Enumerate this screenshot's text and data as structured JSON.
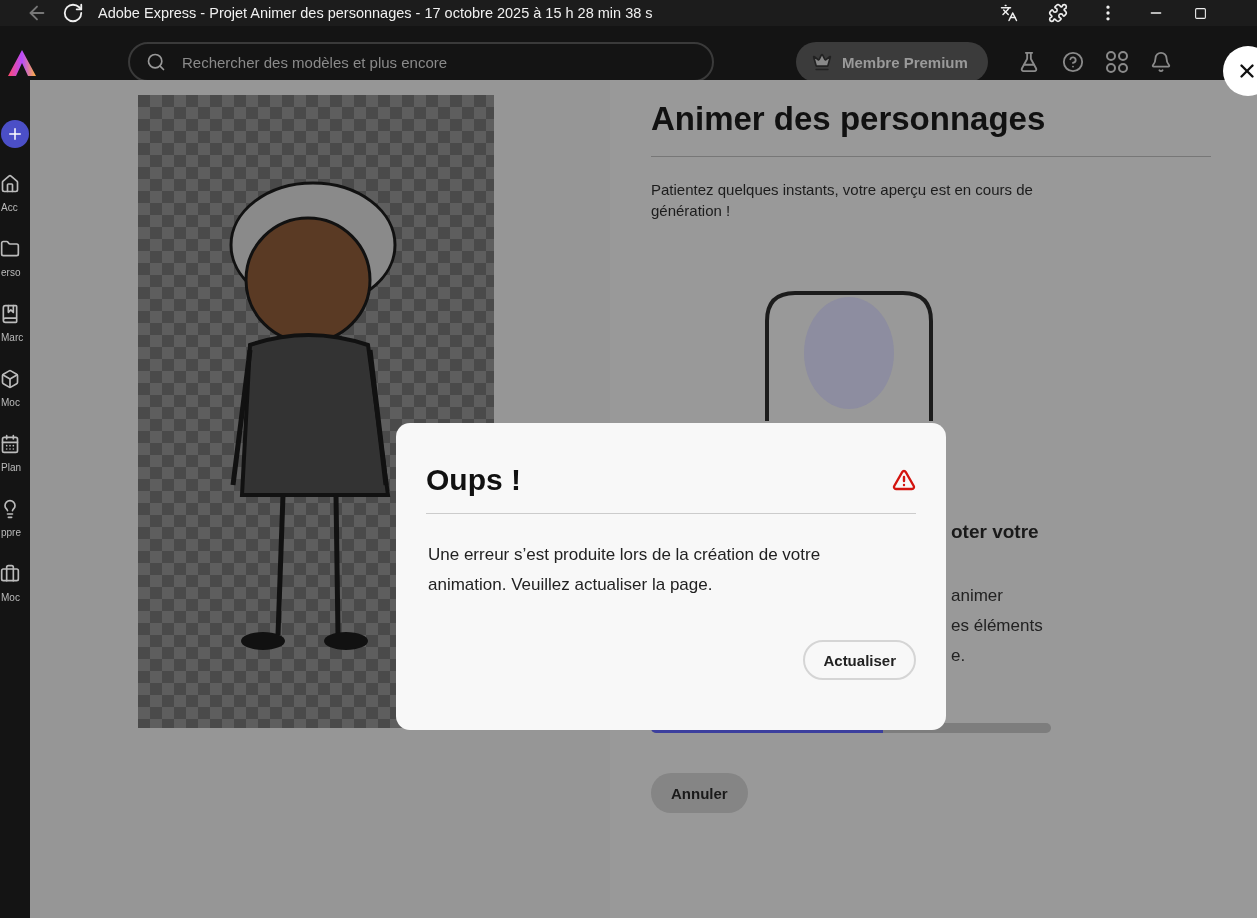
{
  "window": {
    "title": "Adobe Express - Projet Animer des personnages - 17 octobre 2025 à 15 h 28 min 38 s"
  },
  "header": {
    "search": {
      "placeholder": "Rechercher des modèles et plus encore"
    },
    "premium_button": "Membre Premium"
  },
  "sidebar": {
    "items": [
      {
        "label": "Acc"
      },
      {
        "label": "erso"
      },
      {
        "label": "Marc"
      },
      {
        "label": "Moc"
      },
      {
        "label": "Plan"
      },
      {
        "label": "ppre"
      },
      {
        "label": "Moc"
      }
    ]
  },
  "panel": {
    "title": "Animer des personnages",
    "message": "Patientez quelques instants, votre aperçu est en cours de génération !",
    "hidden_heading": "oter votre",
    "hidden_lines": [
      "animer",
      "es éléments",
      "e."
    ],
    "progress": {
      "level": 0.58
    },
    "cancel_button": "Annuler"
  },
  "dialog": {
    "title": "Oups !",
    "message": "Une erreur s’est produite lors de la création de votre animation. Veuillez actualiser la page.",
    "button": "Actualiser"
  }
}
